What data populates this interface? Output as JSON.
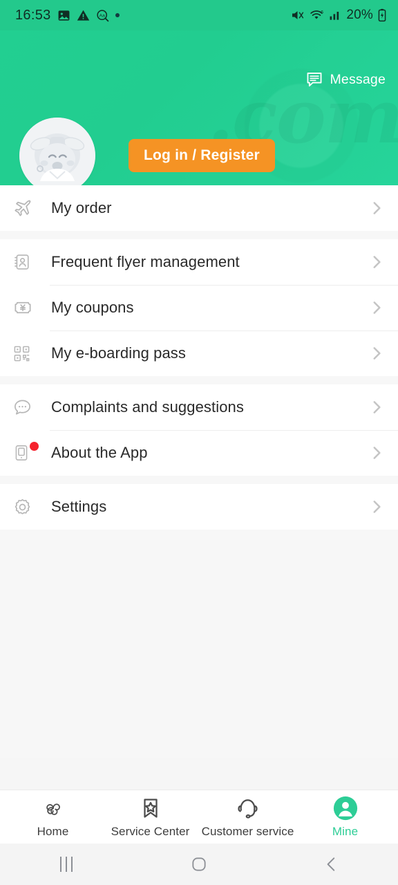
{
  "status_bar": {
    "time": "16:53",
    "left_icons": [
      "image-icon",
      "warning-icon",
      "font-size-icon",
      "dot-icon"
    ],
    "right_icons": [
      "mute-icon",
      "wifi-icon",
      "signal-icon"
    ],
    "wifi_generation": "6",
    "battery_percent": "20%",
    "battery_state": "charging"
  },
  "header": {
    "message_label": "Message",
    "message_icon": "chat-bubble-icon",
    "login_button": "Log in / Register",
    "avatar_alt": "mascot-avatar",
    "watermark": ".com",
    "background_color": "#22cf91",
    "accent_color": "#f59324"
  },
  "menu": {
    "groups": [
      {
        "items": [
          {
            "label": "My order",
            "icon": "airplane-icon",
            "badge": false
          }
        ]
      },
      {
        "items": [
          {
            "label": "Frequent flyer management",
            "icon": "contact-card-icon",
            "badge": false
          },
          {
            "label": "My coupons",
            "icon": "coupon-ticket-icon",
            "badge": false
          },
          {
            "label": "My e-boarding pass",
            "icon": "qr-code-icon",
            "badge": false
          }
        ]
      },
      {
        "items": [
          {
            "label": "Complaints and suggestions",
            "icon": "speech-bubble-icon",
            "badge": false
          },
          {
            "label": "About the App",
            "icon": "mobile-app-icon",
            "badge": true
          }
        ]
      },
      {
        "items": [
          {
            "label": "Settings",
            "icon": "gear-icon",
            "badge": false
          }
        ]
      }
    ],
    "chevron_icon": "chevron-right-icon",
    "badge_color": "#f5222d"
  },
  "tabbar": {
    "active_color": "#2dcd96",
    "items": [
      {
        "label": "Home",
        "icon": "spiral-logo-icon",
        "active": false
      },
      {
        "label": "Service Center",
        "icon": "bookmark-star-icon",
        "active": false
      },
      {
        "label": "Customer service",
        "icon": "headset-icon",
        "active": false
      },
      {
        "label": "Mine",
        "icon": "person-circle-icon",
        "active": true
      }
    ]
  },
  "system_nav": {
    "recents_icon": "recents-icon",
    "home_icon": "home-square-icon",
    "back_icon": "back-chevron-icon"
  }
}
